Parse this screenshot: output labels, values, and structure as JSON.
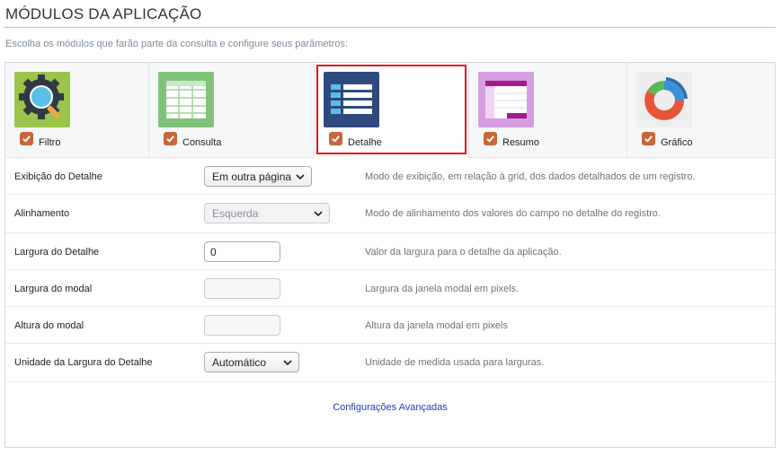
{
  "header": {
    "title": "MÓDULOS DA APLICAÇÃO",
    "subtitle": "Escolha os módulos que farão parte da consulta e configure seus parâmetros:"
  },
  "modules": [
    {
      "label": "Filtro",
      "icon": "filter-gear-icon",
      "checked": true,
      "selected": false
    },
    {
      "label": "Consulta",
      "icon": "grid-table-icon",
      "checked": true,
      "selected": false
    },
    {
      "label": "Detalhe",
      "icon": "detail-list-icon",
      "checked": true,
      "selected": true
    },
    {
      "label": "Resumo",
      "icon": "summary-table-icon",
      "checked": true,
      "selected": false
    },
    {
      "label": "Gráfico",
      "icon": "chart-donut-icon",
      "checked": true,
      "selected": false
    }
  ],
  "settings": [
    {
      "label": "Exibição do Detalhe",
      "control": "select",
      "value": "Em outra página",
      "disabled": false,
      "description": "Modo de exibição, em relação à grid, dos dados detalhados de um registro."
    },
    {
      "label": "Alinhamento",
      "control": "select",
      "value": "Esquerda",
      "disabled": true,
      "description": "Modo de alinhamento dos valores do campo no detalhe do registro."
    },
    {
      "label": "Largura do Detalhe",
      "control": "input",
      "value": "0",
      "disabled": false,
      "description": "Valor da largura para o detalhe da aplicação."
    },
    {
      "label": "Largura do modal",
      "control": "input",
      "value": "",
      "disabled": true,
      "description": "Largura da janela modal em pixels."
    },
    {
      "label": "Altura do modal",
      "control": "input",
      "value": "",
      "disabled": true,
      "description": "Altura da janela modal em pixels"
    },
    {
      "label": "Unidade da Largura do Detalhe",
      "control": "select",
      "value": "Automático",
      "disabled": false,
      "description": "Unidade de medida usada para larguras."
    }
  ],
  "advanced_link": "Configurações Avançadas",
  "colors": {
    "selected_border": "#e0141b",
    "checkbox": "#c8653a",
    "link": "#1b3fc6"
  }
}
